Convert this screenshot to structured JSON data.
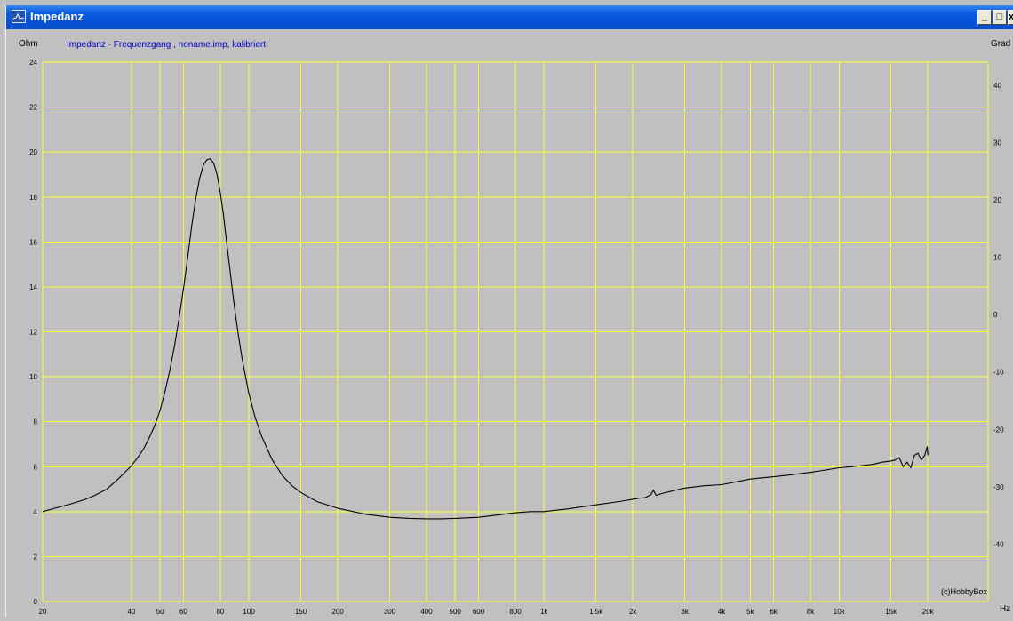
{
  "window": {
    "title": "Impedanz",
    "controls": [
      "_",
      "□",
      "x"
    ]
  },
  "chart_data": {
    "type": "line",
    "title": "Impedanz - Frequenzgang , noname.imp, kalibriert",
    "xlabel": "Hz",
    "ylabel": "Ohm",
    "y2label": "Grad",
    "xscale": "log",
    "xlim": [
      20,
      32000
    ],
    "ylim": [
      0,
      24
    ],
    "y2lim": [
      -50,
      44
    ],
    "xticks": [
      20,
      40,
      50,
      60,
      80,
      100,
      150,
      200,
      300,
      400,
      500,
      600,
      800,
      1000,
      1500,
      2000,
      3000,
      4000,
      5000,
      6000,
      8000,
      10000,
      15000,
      20000
    ],
    "xtick_labels": [
      "20",
      "40",
      "50",
      "60",
      "80",
      "100",
      "150",
      "200",
      "300",
      "400",
      "500",
      "600",
      "800",
      "1k",
      "1,5k",
      "2k",
      "3k",
      "4k",
      "5k",
      "6k",
      "8k",
      "10k",
      "15k",
      "20k"
    ],
    "yticks": [
      0,
      2,
      4,
      6,
      8,
      10,
      12,
      14,
      16,
      18,
      20,
      22,
      24
    ],
    "y2ticks": [
      -40,
      -30,
      -20,
      -10,
      0,
      10,
      20,
      30,
      40
    ],
    "grid": true,
    "colors": {
      "grid": "#ffff33",
      "line": "#000000",
      "background": "#c0c0c0",
      "title": "#0000cc"
    },
    "annotation": "(c)HobbyBox",
    "series": [
      {
        "x": [
          20,
          22,
          25,
          28,
          30,
          33,
          36,
          38,
          40,
          42,
          44,
          46,
          48,
          50,
          52,
          54,
          56,
          58,
          60,
          62,
          64,
          66,
          68,
          70,
          72,
          74,
          76,
          78,
          80,
          82,
          84,
          86,
          88,
          90,
          92,
          95,
          100,
          105,
          110,
          120,
          130,
          140,
          150,
          170,
          200,
          250,
          300,
          350,
          400,
          450,
          500,
          600,
          700,
          800,
          900,
          1000,
          1200,
          1500,
          1800,
          2000,
          2100,
          2200,
          2300,
          2350,
          2400,
          2500,
          3000,
          3500,
          4000,
          5000,
          6000,
          7000,
          8000,
          9000,
          10000,
          11000,
          12000,
          13000,
          14000,
          15000,
          15500,
          16000,
          16500,
          17000,
          17500,
          18000,
          18500,
          19000,
          19500,
          19900,
          20000
        ],
        "y": [
          4.0,
          4.15,
          4.35,
          4.55,
          4.72,
          5.0,
          5.45,
          5.75,
          6.05,
          6.4,
          6.8,
          7.3,
          7.85,
          8.5,
          9.35,
          10.3,
          11.4,
          12.6,
          13.9,
          15.3,
          16.7,
          17.9,
          18.8,
          19.4,
          19.65,
          19.7,
          19.5,
          19.0,
          18.2,
          17.2,
          16.0,
          14.9,
          13.8,
          12.8,
          11.9,
          10.75,
          9.25,
          8.2,
          7.4,
          6.3,
          5.6,
          5.15,
          4.85,
          4.45,
          4.15,
          3.88,
          3.75,
          3.7,
          3.68,
          3.68,
          3.7,
          3.75,
          3.85,
          3.95,
          4.0,
          4.0,
          4.12,
          4.3,
          4.45,
          4.55,
          4.6,
          4.62,
          4.75,
          4.95,
          4.72,
          4.8,
          5.05,
          5.15,
          5.2,
          5.45,
          5.55,
          5.65,
          5.75,
          5.85,
          5.95,
          6.0,
          6.05,
          6.1,
          6.2,
          6.25,
          6.3,
          6.4,
          6.0,
          6.2,
          5.95,
          6.5,
          6.6,
          6.3,
          6.5,
          6.9,
          6.5
        ]
      }
    ]
  }
}
